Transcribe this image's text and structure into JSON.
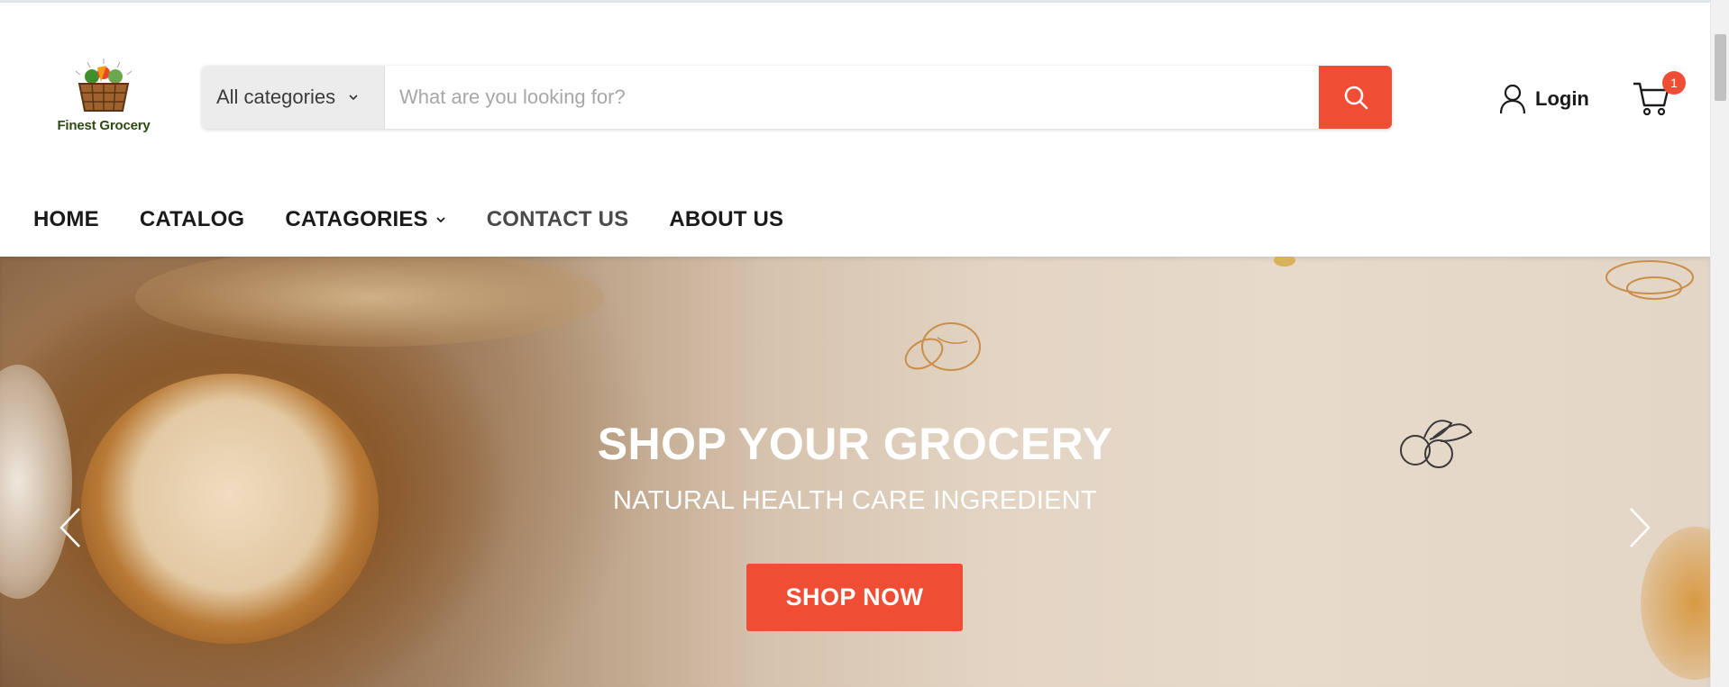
{
  "brand": {
    "name": "Finest Grocery",
    "accent": "#ef4e34"
  },
  "search": {
    "category_value": "All categories",
    "placeholder": "What are you looking for?",
    "value": ""
  },
  "account": {
    "login_label": "Login"
  },
  "cart": {
    "count": "1"
  },
  "nav": {
    "items": [
      {
        "label": "HOME"
      },
      {
        "label": "CATALOG"
      },
      {
        "label": "CATAGORIES"
      },
      {
        "label": "CONTACT US"
      },
      {
        "label": "ABOUT US"
      }
    ]
  },
  "hero": {
    "title": "SHOP YOUR GROCERY",
    "subtitle": "NATURAL HEALTH CARE INGREDIENT",
    "cta_label": "SHOP NOW"
  },
  "icons": {
    "search": "search-icon",
    "user": "user-icon",
    "cart": "cart-icon",
    "chevron": "chevron-down-icon",
    "prev": "chevron-left-icon",
    "next": "chevron-right-icon"
  }
}
